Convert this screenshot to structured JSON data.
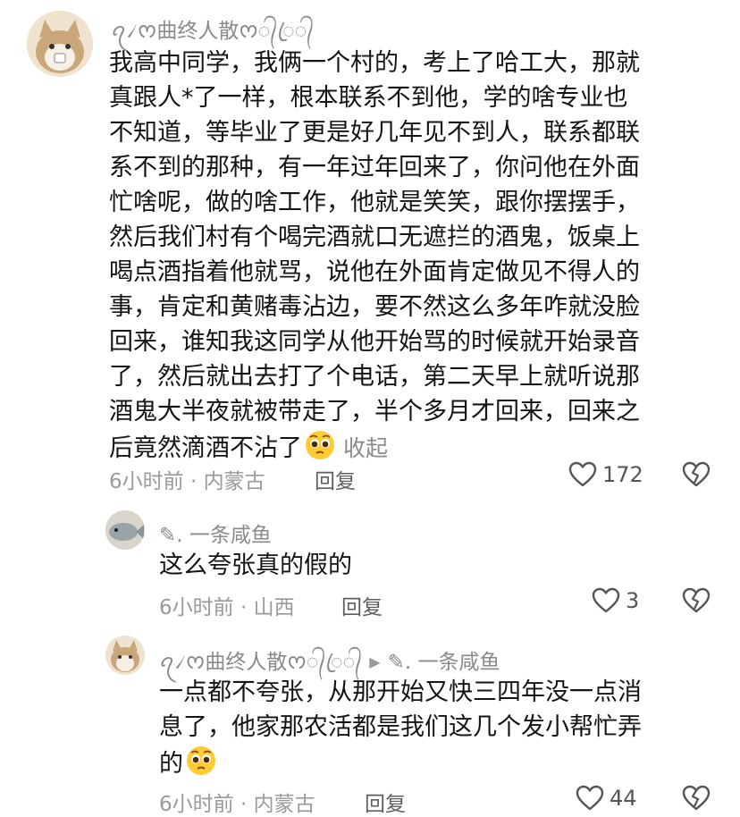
{
  "main_comment": {
    "username": "ꪖ৴ᰔ曲终人散ᰔ᭄ꦿ᭄",
    "lines": [
      "我高中同学，我俩一个村的，考上了哈工大，那就",
      "真跟人*了一样，根本联系不到他，学的啥专业也",
      "不知道，等毕业了更是好几年见不到人，联系都联",
      "系不到的那种，有一年过年回来了，你问他在外面",
      "忙啥呢，做的啥工作，他就是笑笑，跟你摆摆手，",
      "然后我们村有个喝完酒就口无遮拦的酒鬼，饭桌上",
      "喝点酒指着他就骂，说他在外面肯定做见不得人的",
      "事，肯定和黄赌毒沾边，要不然这么多年咋就没脸",
      "回来，谁知我这同学从他开始骂的时候就开始录音",
      "了，然后就出去打了个电话，第二天早上就听说那",
      "酒鬼大半夜就被带走了，半个多月才回来，回来之",
      "后竟然滴酒不沾了"
    ],
    "collapse": "收起",
    "meta": "6小时前 · 内蒙古",
    "reply": "回复",
    "likes": "172"
  },
  "reply1": {
    "username": "✎. 一条咸鱼",
    "text": "这么夸张真的假的",
    "meta": "6小时前 · 山西",
    "reply": "回复",
    "likes": "3"
  },
  "reply2": {
    "username": "ꪖ৴ᰔ曲终人散ᰔ᭄ꦿ᭄",
    "reply_to": "✎. 一条咸鱼",
    "lines": [
      "一点都不夸张，从那开始又快三四年没一点消",
      "息了，他家那农活都是我们这几个发小帮忙弄",
      "的"
    ],
    "meta": "6小时前 · 内蒙古",
    "reply": "回复",
    "likes": "44"
  },
  "icons": {
    "like": "heart-outline-icon",
    "dislike": "broken-heart-icon",
    "emoji": "pleading-face-emoji"
  }
}
